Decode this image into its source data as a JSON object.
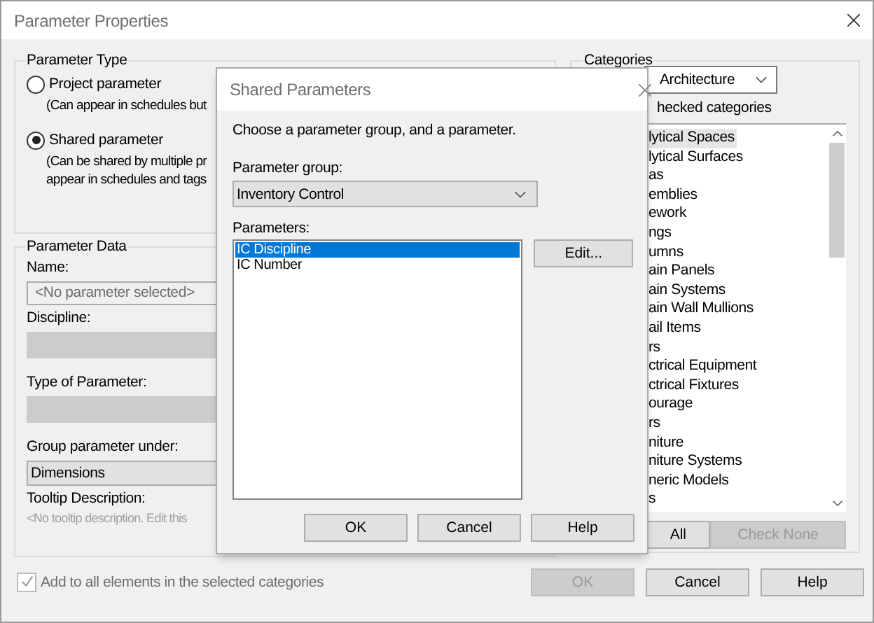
{
  "window": {
    "title": "Parameter Properties"
  },
  "parameter_type": {
    "title": "Parameter Type",
    "options": [
      {
        "label": "Project parameter",
        "description": [
          "(Can appear in schedules but"
        ],
        "selected": false
      },
      {
        "label": "Shared parameter",
        "description": [
          "(Can be shared by multiple pr",
          "appear in schedules and tags"
        ],
        "selected": true
      }
    ]
  },
  "parameter_data": {
    "title": "Parameter Data",
    "fields": [
      {
        "label": "Name:",
        "kind": "input",
        "placeholder": "<No parameter selected>"
      },
      {
        "label": "Discipline:",
        "kind": "input",
        "disabled": true
      },
      {
        "label": "Type of Parameter:",
        "kind": "input",
        "disabled": true
      },
      {
        "label": "Group parameter under:",
        "kind": "select",
        "value": "Dimensions"
      },
      {
        "label": "Tooltip Description:",
        "kind": "note",
        "value": "<No tooltip description. Edit this"
      }
    ]
  },
  "add_to_all": {
    "label": "Add to all elements in the selected categories",
    "checked": true,
    "disabled": true
  },
  "categories": {
    "title": "Categories",
    "filter": "Architecture",
    "hint": "hecked categories",
    "items": [
      {
        "label": "lytical Spaces",
        "selected": true
      },
      {
        "label": "lytical Surfaces",
        "selected": false
      },
      {
        "label": "as",
        "selected": false
      },
      {
        "label": "emblies",
        "selected": false
      },
      {
        "label": "ework",
        "selected": false
      },
      {
        "label": "ngs",
        "selected": false
      },
      {
        "label": "umns",
        "selected": false
      },
      {
        "label": "ain Panels",
        "selected": false
      },
      {
        "label": "ain Systems",
        "selected": false
      },
      {
        "label": "ain Wall Mullions",
        "selected": false
      },
      {
        "label": "ail Items",
        "selected": false
      },
      {
        "label": "rs",
        "selected": false
      },
      {
        "label": "ctrical Equipment",
        "selected": false
      },
      {
        "label": "ctrical Fixtures",
        "selected": false
      },
      {
        "label": "ourage",
        "selected": false
      },
      {
        "label": "rs",
        "selected": false
      },
      {
        "label": "niture",
        "selected": false
      },
      {
        "label": "niture Systems",
        "selected": false
      },
      {
        "label": "neric Models",
        "selected": false
      },
      {
        "label": "s",
        "selected": false
      }
    ],
    "buttons": [
      {
        "label": "All",
        "disabled": false
      },
      {
        "label": "Check None",
        "disabled": true
      }
    ]
  },
  "buttons": [
    {
      "label": "OK",
      "disabled": true
    },
    {
      "label": "Cancel",
      "disabled": false
    },
    {
      "label": "Help",
      "disabled": false
    }
  ],
  "dialog": {
    "title": "Shared Parameters",
    "prompt": "Choose a parameter group, and a parameter.",
    "group_label": "Parameter group:",
    "group": "Inventory Control",
    "list_label": "Parameters:",
    "parameters": [
      {
        "label": "IC Discipline",
        "selected": true
      },
      {
        "label": "IC Number",
        "selected": false
      }
    ],
    "edit_button": "Edit...",
    "buttons": [
      "OK",
      "Cancel",
      "Help"
    ]
  }
}
